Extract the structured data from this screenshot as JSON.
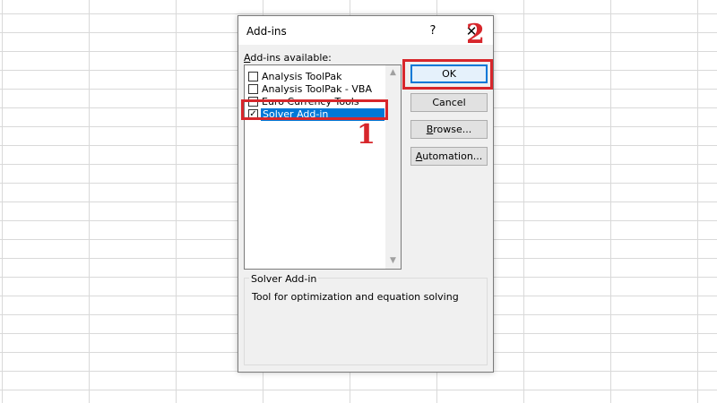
{
  "dialog": {
    "title": "Add-ins",
    "help_glyph": "?",
    "close_glyph": "✕",
    "list_label_prefix": "A",
    "list_label_rest": "dd-ins available:",
    "items": [
      {
        "label": "Analysis ToolPak",
        "checked": false,
        "selected": false
      },
      {
        "label": "Analysis ToolPak - VBA",
        "checked": false,
        "selected": false
      },
      {
        "label": "Euro Currency Tools",
        "checked": false,
        "selected": false
      },
      {
        "label": "Solver Add-in",
        "checked": true,
        "selected": true
      }
    ],
    "check_glyph": "✓",
    "buttons": {
      "ok": "OK",
      "cancel": "Cancel",
      "browse_prefix": "B",
      "browse_rest": "rowse...",
      "automation_prefix": "A",
      "automation_rest": "utomation..."
    },
    "description": {
      "title": "Solver Add-in",
      "text": "Tool for optimization and equation solving"
    },
    "scroll": {
      "up": "▲",
      "down": "▼"
    }
  },
  "annotations": {
    "marker_1": "1",
    "marker_2": "2",
    "color": "#d7262b"
  }
}
